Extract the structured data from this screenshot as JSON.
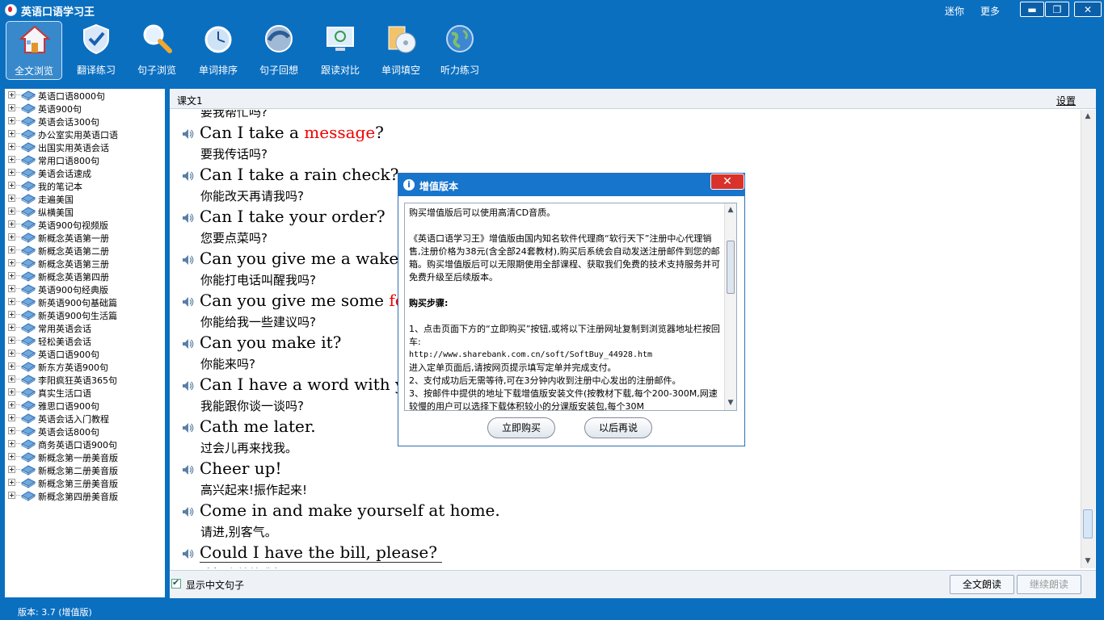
{
  "window": {
    "title": "英语口语学习王",
    "link_1": "迷你",
    "link_2": "更多",
    "min_glyph": "▬",
    "max_glyph": "❐",
    "close_glyph": "✕"
  },
  "toolbar": {
    "items": [
      {
        "label": "全文浏览",
        "icon": "home-icon"
      },
      {
        "label": "翻译练习",
        "icon": "shield-icon"
      },
      {
        "label": "句子浏览",
        "icon": "magnifier-icon"
      },
      {
        "label": "单词排序",
        "icon": "clock-icon"
      },
      {
        "label": "句子回想",
        "icon": "orb-icon"
      },
      {
        "label": "跟读对比",
        "icon": "monitor-icon"
      },
      {
        "label": "单词填空",
        "icon": "cd-icon"
      },
      {
        "label": "听力练习",
        "icon": "globe-icon"
      }
    ]
  },
  "tree": {
    "items": [
      "英语口语8000句",
      "英语900句",
      "英语会话300句",
      "办公室实用英语口语",
      "出国实用英语会话",
      "常用口语800句",
      "美语会话速成",
      "我的笔记本",
      "走遍美国",
      "纵横美国",
      "英语900句视频版",
      "新概念英语第一册",
      "新概念英语第二册",
      "新概念英语第三册",
      "新概念英语第四册",
      "英语900句经典版",
      "新英语900句基础篇",
      "新英语900句生活篇",
      "常用英语会话",
      "轻松美语会话",
      "英语口语900句",
      "新东方英语900句",
      "李阳疯狂英语365句",
      "真实生活口语",
      "雅思口语900句",
      "英语会话入门教程",
      "英语会话800句",
      "商务英语口语900句",
      "新概念第一册美音版",
      "新概念第二册美音版",
      "新概念第三册美音版",
      "新概念第四册美音版"
    ]
  },
  "main": {
    "lesson_title": "课文1",
    "settings": "设置",
    "partial_top": "要我帮忙吗?",
    "sentences": [
      {
        "before": "Can I take a ",
        "hl": "message",
        "after": "?",
        "cn": "要我传话吗?"
      },
      {
        "before": "Can I take a rain check?",
        "hl": "",
        "after": "",
        "cn": "你能改天再请我吗?"
      },
      {
        "before": "Can I take your order?",
        "hl": "",
        "after": "",
        "cn": "您要点菜吗?"
      },
      {
        "before": "Can you give me a wake-u",
        "hl": "",
        "after": "",
        "cn": "你能打电话叫醒我吗?"
      },
      {
        "before": "Can you give me some ",
        "hl": "fee",
        "after": "",
        "cn": "你能给我一些建议吗?"
      },
      {
        "before": "Can you make it?",
        "hl": "",
        "after": "",
        "cn": "你能来吗?"
      },
      {
        "before": "Can I have a word with yo",
        "hl": "",
        "after": "",
        "cn": "我能跟你谈一谈吗?"
      },
      {
        "before": "Cath me later.",
        "hl": "",
        "after": "",
        "cn": "过会儿再来找我。"
      },
      {
        "before": "Cheer up!",
        "hl": "",
        "after": "",
        "cn": "高兴起来!振作起来!"
      },
      {
        "before": "Come in and make yourself at home.",
        "hl": "",
        "after": "",
        "cn": "请进,别客气。"
      },
      {
        "before": "Could I have the bill, please?",
        "hl": "",
        "after": "",
        "cn": "请把账单给我好吗?"
      }
    ],
    "show_chinese_label": "显示中文句子",
    "read_all_button": "全文朗读",
    "continue_button": "继续朗读"
  },
  "status": {
    "version_text": "版本: 3.7  (增值版)"
  },
  "dialog": {
    "title": "增值版本",
    "paragraphs": [
      "购买增值版后可以使用高清CD音质。",
      "",
      "《英语口语学习王》增值版由国内知名软件代理商“软行天下”注册中心代理销售,注册价格为38元(含全部24套教材),购买后系统会自动发送注册邮件到您的邮箱。购买增值版后可以无限期使用全部课程、获取我们免费的技术支持服务并可免费升级至后续版本。",
      "",
      "购买步骤:",
      "",
      "1、点击页面下方的“立即购买”按钮,或将以下注册网址复制到浏览器地址栏按回车:",
      "http://www.sharebank.com.cn/soft/SoftBuy_44928.htm",
      "进入定单页面后,请按网页提示填写定单并完成支付。",
      "2、支付成功后无需等待,可在3分钟内收到注册中心发出的注册邮件。",
      "3、按邮件中提供的地址下载增值版安装文件(按教材下载,每个200-300M,网速较慢的用户可以选择下载体积较小的分课版安装包,每个30M"
    ],
    "buy_button": "立即购买",
    "later_button": "以后再说",
    "close_glyph": "✕"
  },
  "colors": {
    "window_blue": "#0b6fc0",
    "highlight_red": "#ee0000",
    "dialog_close_red": "#d9322a"
  }
}
